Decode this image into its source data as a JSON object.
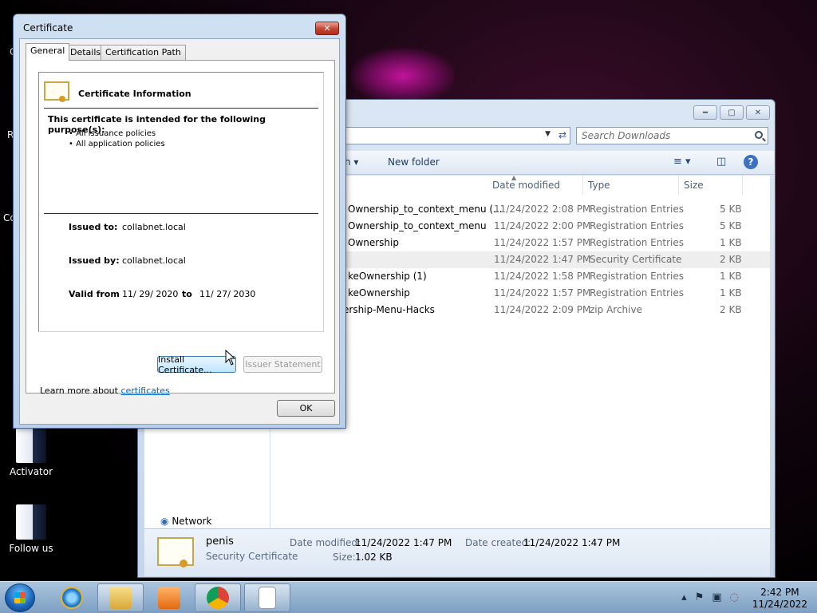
{
  "desktop": {
    "icons": [
      {
        "label": "Activator"
      },
      {
        "label": "Follow us"
      }
    ],
    "side_labels": [
      "C",
      "R",
      "Co"
    ]
  },
  "explorer": {
    "search_placeholder": "Search Downloads",
    "toolbar": {
      "organize_fragment": "h",
      "new_folder": "New folder"
    },
    "columns": [
      "Date modified",
      "Type",
      "Size"
    ],
    "files": [
      {
        "name": "Ownership_to_context_menu (...",
        "date": "11/24/2022 2:08 PM",
        "type": "Registration Entries",
        "size": "5 KB"
      },
      {
        "name": "Ownership_to_context_menu",
        "date": "11/24/2022 2:00 PM",
        "type": "Registration Entries",
        "size": "5 KB"
      },
      {
        "name": "Ownership",
        "date": "11/24/2022 1:57 PM",
        "type": "Registration Entries",
        "size": "1 KB"
      },
      {
        "name": "",
        "date": "11/24/2022 1:47 PM",
        "type": "Security Certificate",
        "size": "2 KB"
      },
      {
        "name": "keOwnership (1)",
        "date": "11/24/2022 1:58 PM",
        "type": "Registration Entries",
        "size": "1 KB"
      },
      {
        "name": "keOwnership",
        "date": "11/24/2022 1:57 PM",
        "type": "Registration Entries",
        "size": "1 KB"
      },
      {
        "name": "ership-Menu-Hacks",
        "date": "11/24/2022 2:09 PM",
        "type": "zip Archive",
        "size": "2 KB"
      }
    ],
    "nav": {
      "network": "Network"
    },
    "details": {
      "name": "penis",
      "type": "Security Certificate",
      "date_modified_label": "Date modified:",
      "date_modified": "11/24/2022 1:47 PM",
      "date_created_label": "Date created:",
      "date_created": "11/24/2022 1:47 PM",
      "size_label": "Size:",
      "size": "1.02 KB"
    }
  },
  "cert_dialog": {
    "title": "Certificate",
    "tabs": [
      "General",
      "Details",
      "Certification Path"
    ],
    "heading": "Certificate Information",
    "purpose_heading": "This certificate is intended for the following purpose(s):",
    "purposes": [
      "• All issuance policies",
      "• All application policies"
    ],
    "issued_to_label": "Issued to:",
    "issued_to": "collabnet.local",
    "issued_by_label": "Issued by:",
    "issued_by": "collabnet.local",
    "valid_from_label": "Valid from",
    "valid_from": "11/ 29/ 2020",
    "to_label": "to",
    "valid_to": "11/ 27/ 2030",
    "install_button": "Install Certificate...",
    "issuer_statement_button": "Issuer Statement",
    "learn_more_text": "Learn more about ",
    "learn_more_link": "certificates",
    "ok_button": "OK"
  },
  "taskbar": {
    "time": "2:42 PM",
    "date": "11/24/2022"
  }
}
